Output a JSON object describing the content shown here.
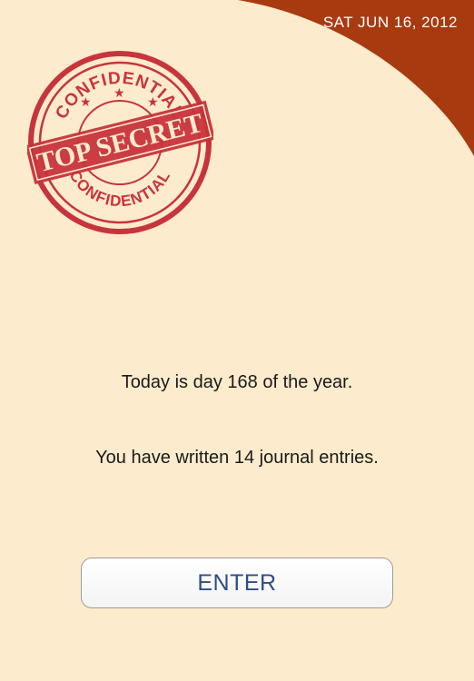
{
  "header": {
    "date": "SAT JUN 16, 2012"
  },
  "stamp": {
    "top_text": "CONFIDENTIAL",
    "center_text": "TOP SECRET",
    "bottom_text": "CONFIDENTIAL",
    "color": "#c8343b"
  },
  "main": {
    "day_message": "Today is day 168 of the year.",
    "entries_message": "You have written 14 journal entries."
  },
  "actions": {
    "enter_label": "ENTER"
  },
  "colors": {
    "background": "#fdebcd",
    "corner_accent": "#a83a10",
    "button_text": "#2f4d86"
  }
}
